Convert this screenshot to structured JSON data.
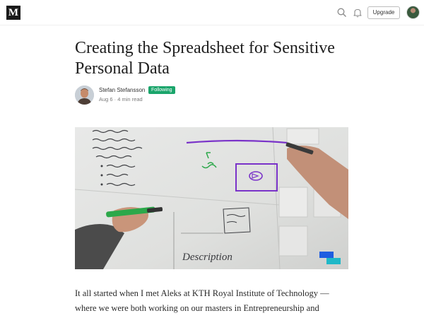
{
  "header": {
    "logo_text": "M",
    "upgrade_label": "Upgrade",
    "icons": [
      "search-icon",
      "bell-icon",
      "user-avatar"
    ]
  },
  "article": {
    "title": "Creating the Spreadsheet for Sensitive Personal Data",
    "author": {
      "name": "Stefan Stefansson",
      "follow_status": "Following",
      "date": "Aug 6",
      "read_time": "4 min read",
      "meta": "Aug 6 · 4 min read"
    },
    "hero_image": {
      "whiteboard_text": "Description"
    },
    "body": {
      "line_1": "It all started when I met Aleks at KTH Royal Institute of Technology —",
      "line_2": "where we were both working on our masters in Entrepreneurship and"
    }
  },
  "colors": {
    "follow_badge": "#1aa56b",
    "logo_bg": "#1a1a1a",
    "marker_purple": "#7a33c9",
    "marker_green": "#2ca84a",
    "hero_accent": "#1e5de0"
  }
}
